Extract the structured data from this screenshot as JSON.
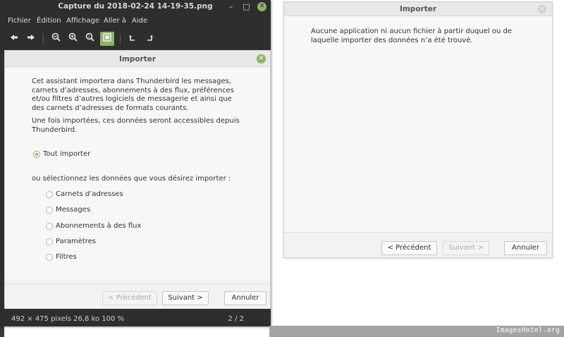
{
  "viewer": {
    "title": "Capture du 2018-02-24 14-19-35.png",
    "window_controls": {
      "minimize": "–",
      "maximize": "□",
      "close": "✕"
    },
    "menu": [
      "Fichier",
      "Édition",
      "Affichage",
      "Aller à",
      "Aide"
    ],
    "toolbar": {
      "back_icon": "arrow-left-icon",
      "forward_icon": "arrow-right-icon",
      "zoom_out_icon": "zoom-out-icon",
      "zoom_in_icon": "zoom-in-icon",
      "zoom_fit_icon": "zoom-fit-icon",
      "best_fit_icon": "best-fit-icon",
      "rotate_left_icon": "rotate-left-icon",
      "rotate_right_icon": "rotate-right-icon"
    },
    "status": {
      "info": "492 × 475 pixels  26,8 ko    100 %",
      "page": "2 / 2"
    }
  },
  "import_left": {
    "title": "Importer",
    "intro": "Cet assistant importera dans Thunderbird les messages, carnets d’adresses, abonnements à des flux, préférences et/ou filtres d’autres logiciels de messagerie et ainsi que des carnets d’adresses de formats courants.",
    "intro2": "Une fois importées, ces données seront accessibles depuis Thunderbird.",
    "import_all": "Tout importer",
    "or_select": "ou sélectionnez les données que vous désirez importer :",
    "options": [
      "Carnets d’adresses",
      "Messages",
      "Abonnements à des flux",
      "Paramètres",
      "Filtres"
    ],
    "buttons": {
      "previous": "< Précédent",
      "next": "Suivant >",
      "cancel": "Annuler"
    }
  },
  "import_right": {
    "title": "Importer",
    "message": "Aucune application ni aucun fichier à partir duquel ou de laquelle importer des données n’a été trouvé.",
    "buttons": {
      "previous": "< Précédent",
      "next": "Suivant >",
      "cancel": "Annuler"
    }
  },
  "watermark": "ImagesHotel.org",
  "colors": {
    "accent": "#8fb36b",
    "dark": "#2e2e2e"
  }
}
